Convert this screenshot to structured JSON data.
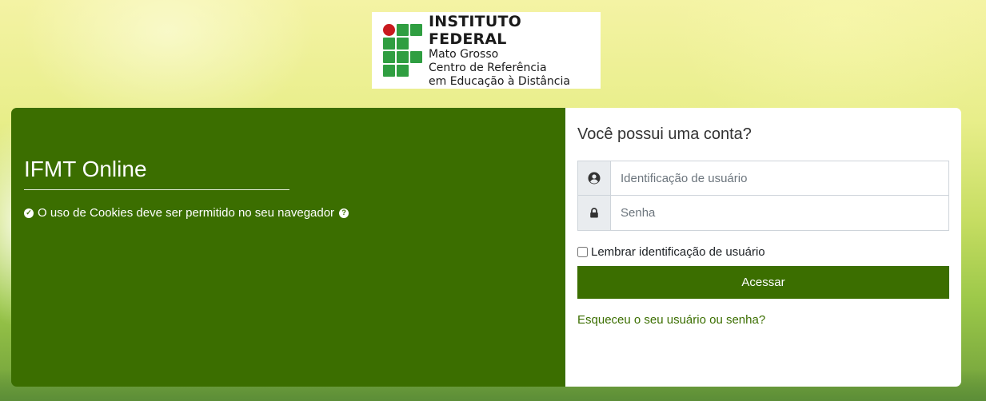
{
  "logo": {
    "title": "INSTITUTO FEDERAL",
    "lines": [
      "Mato Grosso",
      "Centro de Referência",
      "em Educação à Distância"
    ],
    "colors": {
      "green": "#2f9e41",
      "red": "#c8191e"
    }
  },
  "left": {
    "site_title": "IFMT Online",
    "cookie_notice": "O uso de Cookies deve ser permitido no seu navegador",
    "icons": {
      "check": "check-circle-icon",
      "help": "question-circle-icon"
    }
  },
  "login": {
    "heading": "Você possui uma conta?",
    "username": {
      "placeholder": "Identificação de usuário",
      "value": "",
      "icon": "user-icon"
    },
    "password": {
      "placeholder": "Senha",
      "value": "",
      "icon": "lock-icon"
    },
    "remember_label": "Lembrar identificação de usuário",
    "remember_checked": false,
    "submit_label": "Acessar",
    "forgot_link": "Esqueceu o seu usuário ou senha?"
  },
  "colors": {
    "primary": "#3b6e00",
    "panel_bg": "#ffffff"
  }
}
